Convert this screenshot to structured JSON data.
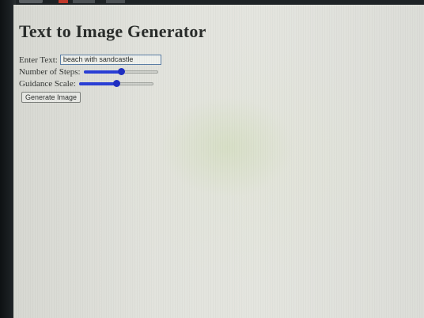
{
  "page": {
    "title": "Text to Image Generator"
  },
  "form": {
    "text_label": "Enter Text:",
    "text_value": "beach with sandcastle",
    "steps_label": "Number of Steps:",
    "steps_level": 0.5,
    "guidance_label": "Guidance Scale:",
    "guidance_level": 0.5,
    "generate_label": "Generate Image"
  },
  "colors": {
    "slider_accent": "#2a3fd6",
    "input_border": "#5c7fa6"
  }
}
